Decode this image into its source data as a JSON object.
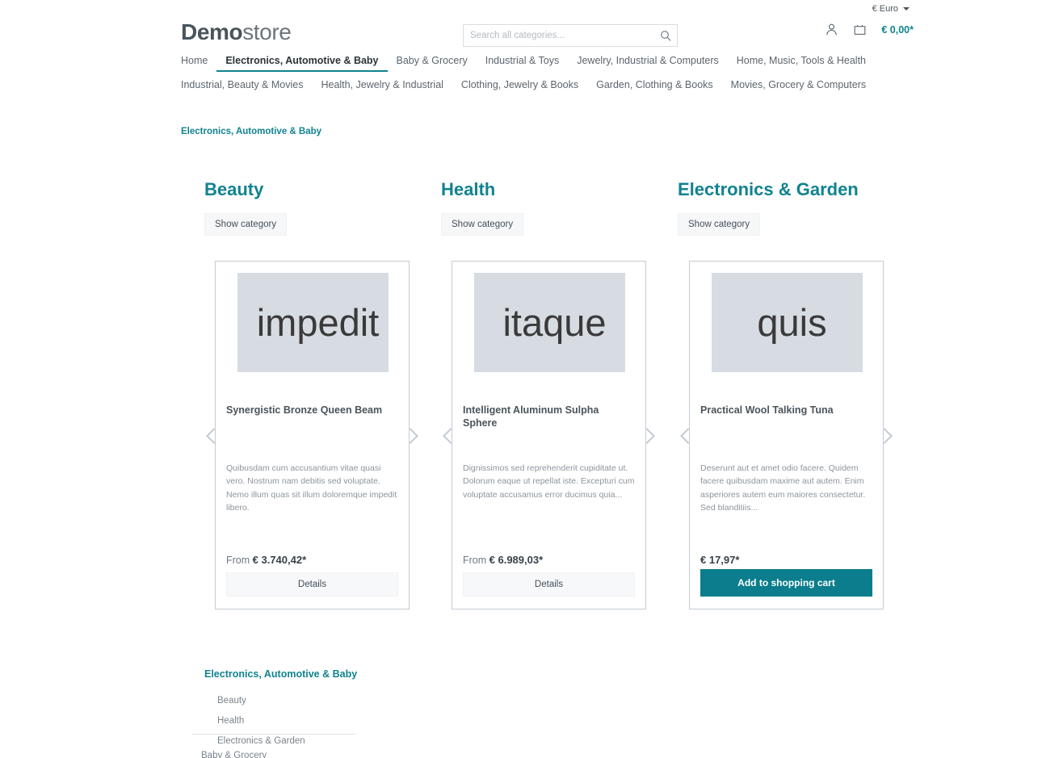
{
  "topbar": {
    "currency_label": "€ Euro",
    "caret_icon": "chevron-down-icon"
  },
  "header": {
    "logo_bold": "Demo",
    "logo_light": "store",
    "search": {
      "placeholder": "Search all categories...",
      "value": "",
      "icon": "search-icon"
    },
    "account_icon": "user-icon",
    "cart_icon": "bag-icon",
    "cart_total": "€ 0,00*"
  },
  "nav": {
    "row1": [
      {
        "label": "Home",
        "active": false
      },
      {
        "label": "Electronics, Automotive & Baby",
        "active": true
      },
      {
        "label": "Baby & Grocery",
        "active": false
      },
      {
        "label": "Industrial & Toys",
        "active": false
      },
      {
        "label": "Jewelry, Industrial & Computers",
        "active": false
      },
      {
        "label": "Home, Music, Tools & Health",
        "active": false
      }
    ],
    "row2": [
      {
        "label": "Industrial, Beauty & Movies"
      },
      {
        "label": "Health, Jewelry & Industrial"
      },
      {
        "label": "Clothing, Jewelry & Books"
      },
      {
        "label": "Garden, Clothing & Books"
      },
      {
        "label": "Movies, Grocery & Computers"
      }
    ]
  },
  "breadcrumb": {
    "label": "Electronics, Automotive & Baby"
  },
  "categories": [
    {
      "title": "Beauty",
      "button": "Show category"
    },
    {
      "title": "Health",
      "button": "Show category"
    },
    {
      "title": "Electronics & Garden",
      "button": "Show category"
    }
  ],
  "products": [
    {
      "image_text": "impedit",
      "title": "Synergistic Bronze Queen Beam",
      "description": "Quibusdam cum accusantium vitae quasi vero. Nostrum nam debitis sed voluptate. Nemo illum quas sit illum doloremque impedit libero.",
      "price_prefix": "From ",
      "price": "€ 3.740,42*",
      "action_label": "Details",
      "action_type": "details"
    },
    {
      "image_text": "itaque",
      "title": "Intelligent Aluminum Sulpha Sphere",
      "description": "Dignissimos sed reprehenderit cupiditate ut. Dolorum eaque ut repellat iste. Excepturi cum voluptate accusamus error ducimus quia...",
      "price_prefix": "From ",
      "price": "€ 6.989,03*",
      "action_label": "Details",
      "action_type": "details"
    },
    {
      "image_text": "quis",
      "title": "Practical Wool Talking Tuna",
      "description": "Deserunt aut et amet odio facere. Quidem facere quibusdam maxime aut autem. Enim asperiores autem eum maiores consectetur. Sed blanditiis...",
      "price_prefix": "",
      "price": "€ 17,97*",
      "action_label": "Add to shopping cart",
      "action_type": "cart"
    }
  ],
  "carousel": {
    "prev_icon": "chevron-left-icon",
    "next_icon": "chevron-right-icon"
  },
  "footer": {
    "title": "Electronics, Automotive & Baby",
    "items": [
      {
        "label": "Beauty"
      },
      {
        "label": "Health"
      },
      {
        "label": "Electronics & Garden"
      }
    ],
    "cut_item": "Baby & Grocery"
  },
  "colors": {
    "accent_teal": "#108390",
    "button_teal": "#0b7d8c",
    "text_gray": "#4a545b",
    "muted_gray": "#8d959c",
    "card_border": "#c5ccd4",
    "placeholder_bg": "#d7dce3"
  }
}
